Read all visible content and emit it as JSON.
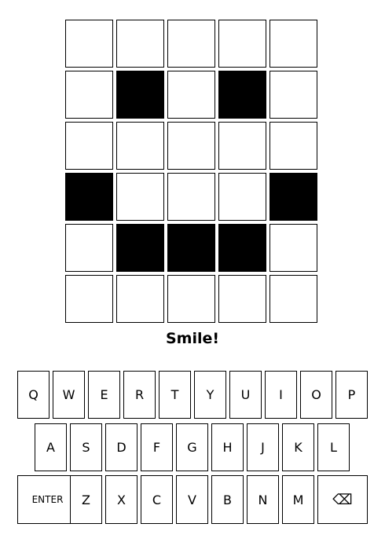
{
  "board": {
    "rows": [
      [
        0,
        0,
        0,
        0,
        0
      ],
      [
        0,
        1,
        0,
        1,
        0
      ],
      [
        0,
        0,
        0,
        0,
        0
      ],
      [
        1,
        0,
        0,
        0,
        1
      ],
      [
        0,
        1,
        1,
        1,
        0
      ],
      [
        0,
        0,
        0,
        0,
        0
      ]
    ]
  },
  "message": "Smile!",
  "keyboard": {
    "rows": [
      [
        "Q",
        "W",
        "E",
        "R",
        "T",
        "Y",
        "U",
        "I",
        "O",
        "P"
      ],
      [
        "A",
        "S",
        "D",
        "F",
        "G",
        "H",
        "J",
        "K",
        "L"
      ],
      [
        "ENTER",
        "Z",
        "X",
        "C",
        "V",
        "B",
        "N",
        "M",
        "⌫"
      ]
    ]
  },
  "colors": {
    "filled": "#000000",
    "empty": "#ffffff",
    "border": "#000000"
  }
}
